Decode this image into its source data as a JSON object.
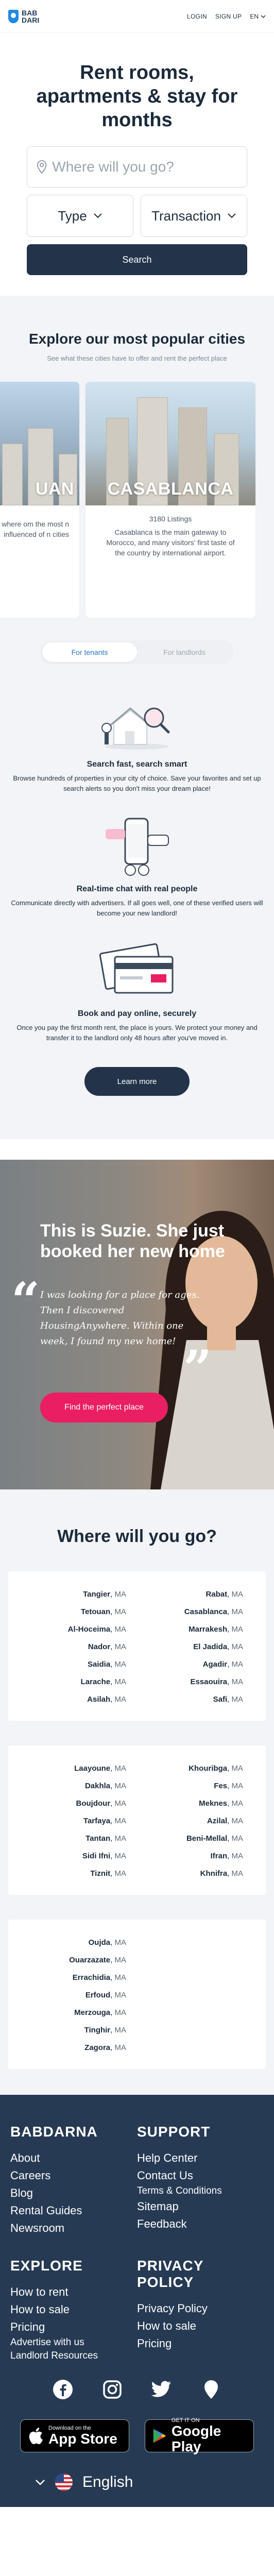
{
  "header": {
    "logo_line1": "BAB",
    "logo_line2": "DARI",
    "login": "LOGIN",
    "signup": "SIGN UP",
    "lang": "EN"
  },
  "hero": {
    "title": "Rent rooms, apartments & stay for months",
    "search_placeholder": "Where will you go?",
    "type_label": "Type",
    "transaction_label": "Transaction",
    "search_button": "Search"
  },
  "cities": {
    "title": "Explore our most popular cities",
    "subtitle": "See what these cities have to offer and rent the perfect place",
    "cards": [
      {
        "name": "UAN",
        "listings": "",
        "desc": "s retaining its ian soul, where om the most n influenced of n cities"
      },
      {
        "name": "CASABLANCA",
        "listings": "3180 Listings",
        "desc": "Casablanca is the main gateway to Morocco, and many visitors' first taste of the country by international airport."
      }
    ]
  },
  "tabs": {
    "tenants": "For tenants",
    "landlords": "For landlords"
  },
  "features": [
    {
      "title": "Search fast, search smart",
      "text": "Browse hundreds of properties in your city of choice. Save your favorites and set up search alerts so you don't miss your dream place!"
    },
    {
      "title": "Real-time chat with real people",
      "text": "Communicate directly with advertisers. If all goes well, one of these verified users will become your new landlord!"
    },
    {
      "title": "Book and pay online, securely",
      "text": "Once you pay the first month rent, the place is yours. We protect your money and transfer it to the landlord only 48 hours after you've moved in."
    }
  ],
  "learn_more": "Learn more",
  "suzie": {
    "title": "This is Suzie. She just booked her new home",
    "quote": "I was looking for a place for ages. Then I discovered HousingAnywhere. Within one week, I found my new home!",
    "button": "Find the perfect place"
  },
  "where": {
    "title": "Where will you go?",
    "regions": [
      {
        "left": [
          {
            "city": "Tangier",
            "c": "MA"
          },
          {
            "city": "Tetouan",
            "c": "MA"
          },
          {
            "city": "Al-Hoceima",
            "c": "MA"
          },
          {
            "city": "Nador",
            "c": "MA"
          },
          {
            "city": "Saidia",
            "c": "MA"
          },
          {
            "city": "Larache",
            "c": "MA"
          },
          {
            "city": "Asilah",
            "c": "MA"
          }
        ],
        "right": [
          {
            "city": "Rabat",
            "c": "MA"
          },
          {
            "city": "Casablanca",
            "c": "MA"
          },
          {
            "city": "Marrakesh",
            "c": "MA"
          },
          {
            "city": "El Jadida",
            "c": "MA"
          },
          {
            "city": "Agadir",
            "c": "MA"
          },
          {
            "city": "Essaouira",
            "c": "MA"
          },
          {
            "city": "Safi",
            "c": "MA"
          }
        ]
      },
      {
        "left": [
          {
            "city": "Laayoune",
            "c": "MA"
          },
          {
            "city": "Dakhla",
            "c": "MA"
          },
          {
            "city": "Boujdour",
            "c": "MA"
          },
          {
            "city": "Tarfaya",
            "c": "MA"
          },
          {
            "city": "Tantan",
            "c": "MA"
          },
          {
            "city": "Sidi Ifni",
            "c": "MA"
          },
          {
            "city": "Tiznit",
            "c": "MA"
          }
        ],
        "right": [
          {
            "city": "Khouribga",
            "c": "MA"
          },
          {
            "city": "Fes",
            "c": "MA"
          },
          {
            "city": "Meknes",
            "c": "MA"
          },
          {
            "city": "Azilal",
            "c": "MA"
          },
          {
            "city": "Beni-Mellal",
            "c": "MA"
          },
          {
            "city": "Ifran",
            "c": "MA"
          },
          {
            "city": "Khnifra",
            "c": "MA"
          }
        ]
      },
      {
        "left": [
          {
            "city": "Oujda",
            "c": "MA"
          },
          {
            "city": "Ouarzazate",
            "c": "MA"
          },
          {
            "city": "Errachidia",
            "c": "MA"
          },
          {
            "city": "Erfoud",
            "c": "MA"
          },
          {
            "city": "Merzouga",
            "c": "MA"
          },
          {
            "city": "Tinghir",
            "c": "MA"
          },
          {
            "city": "Zagora",
            "c": "MA"
          }
        ],
        "right": []
      }
    ]
  },
  "footer": {
    "col1_title": "BABDARNA",
    "col1_links": [
      "About",
      "Careers",
      "Blog",
      "Rental Guides",
      "Newsroom"
    ],
    "col2_title": "SUPPORT",
    "col2_links": [
      "Help Center",
      "Contact Us",
      "Terms & Conditions",
      "Sitemap",
      "Feedback"
    ],
    "col3_title": "EXPLORE",
    "col3_links": [
      "How to rent",
      "How to sale",
      "Pricing",
      "Advertise with us",
      "Landlord Resources"
    ],
    "col4_title": "PRIVACY POLICY",
    "col4_links": [
      "Privacy Policy",
      "How to sale",
      "Pricing"
    ],
    "appstore_small": "Download on the",
    "appstore_big": "App Store",
    "googleplay_small": "GET IT ON",
    "googleplay_big": "Google Play",
    "language": "English"
  },
  "colors": {
    "accent": "#2776c8",
    "dark": "#22334a",
    "pink": "#e91e63",
    "footer": "#263a53"
  }
}
